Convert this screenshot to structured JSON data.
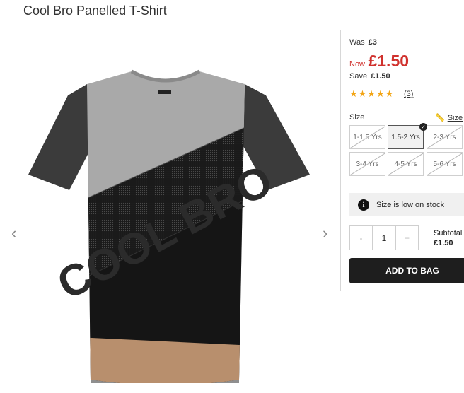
{
  "product": {
    "title": "Cool Bro Panelled T-Shirt",
    "print_text": "COOL BRO"
  },
  "gallery": {
    "prev_icon": "‹",
    "next_icon": "›"
  },
  "price": {
    "was_label": "Was",
    "was_value": "£3",
    "now_label": "Now",
    "now_value": "£1.50",
    "save_label": "Save",
    "save_value": "£1.50"
  },
  "rating": {
    "stars": "★★★★★",
    "count": "(3)",
    "value": 5,
    "max": 5
  },
  "size": {
    "label": "Size",
    "guide_label": "Size",
    "options": [
      {
        "label": "1-1.5 Yrs",
        "available": false
      },
      {
        "label": "1.5-2 Yrs",
        "available": true,
        "selected": true
      },
      {
        "label": "2-3 Yrs",
        "available": false
      },
      {
        "label": "3-4 Yrs",
        "available": false
      },
      {
        "label": "4-5 Yrs",
        "available": false
      },
      {
        "label": "5-6 Yrs",
        "available": false
      }
    ]
  },
  "stock": {
    "icon": "i",
    "message": "Size is low on stock"
  },
  "quantity": {
    "minus": "-",
    "value": "1",
    "plus": "+"
  },
  "subtotal": {
    "label": "Subtotal",
    "value": "£1.50"
  },
  "cta": {
    "add_to_bag": "ADD TO BAG"
  },
  "colors": {
    "price_red": "#d0312d",
    "star": "#f2a516",
    "button": "#1e1e1e"
  }
}
